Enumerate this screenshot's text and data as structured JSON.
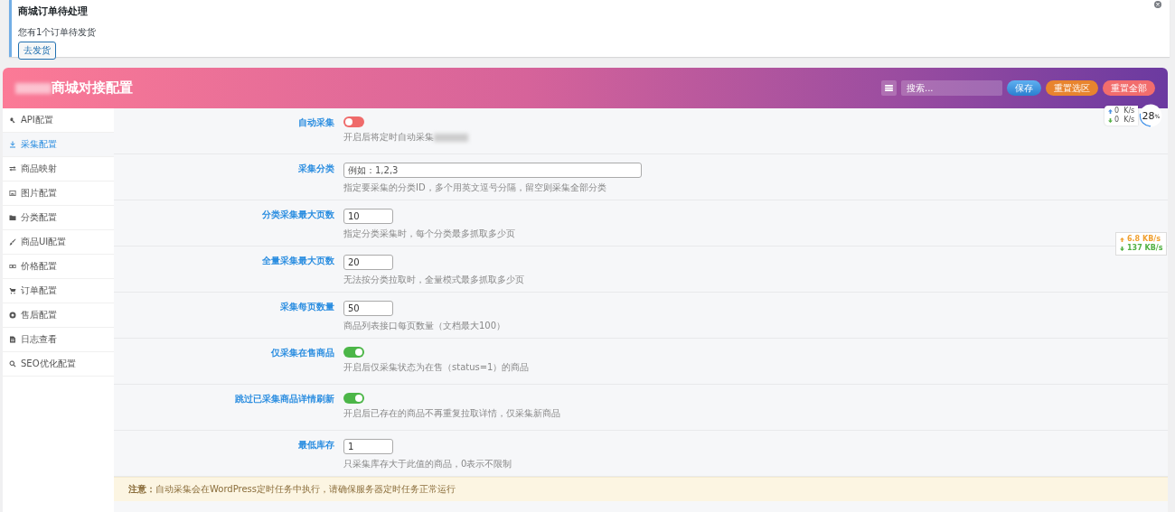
{
  "notice": {
    "title": "商城订单待处理",
    "message": "您有1个订单待发货",
    "button": "去发货"
  },
  "panel": {
    "title": "商城对接配置",
    "search": {
      "placeholder": "搜索..."
    },
    "buttons": [
      {
        "label": "保存",
        "kind": "save"
      },
      {
        "label": "重置选区",
        "kind": "reset"
      },
      {
        "label": "重置全部",
        "kind": "reset_all"
      }
    ]
  },
  "sidebar": {
    "items": [
      {
        "label": "API配置",
        "selected": false
      },
      {
        "label": "采集配置",
        "selected": true
      },
      {
        "label": "商品映射",
        "selected": false
      },
      {
        "label": "图片配置",
        "selected": false
      },
      {
        "label": "分类配置",
        "selected": false
      },
      {
        "label": "商品UI配置",
        "selected": false
      },
      {
        "label": "价格配置",
        "selected": false
      },
      {
        "label": "订单配置",
        "selected": false
      },
      {
        "label": "售后配置",
        "selected": false
      },
      {
        "label": "日志查看",
        "selected": false
      },
      {
        "label": "SEO优化配置",
        "selected": false
      }
    ]
  },
  "fields": [
    {
      "kind": "toggle",
      "label": "自动采集",
      "on": false,
      "hint": "开启后将定时自动采集"
    },
    {
      "kind": "text",
      "label": "采集分类",
      "placeholder": "例如：1,2,3",
      "hint": "指定要采集的分类ID，多个用英文逗号分隔，留空则采集全部分类"
    },
    {
      "kind": "number",
      "label": "分类采集最大页数",
      "value": "10",
      "hint": "指定分类采集时，每个分类最多抓取多少页"
    },
    {
      "kind": "number",
      "label": "全量采集最大页数",
      "value": "20",
      "hint": "无法按分类拉取时，全量模式最多抓取多少页"
    },
    {
      "kind": "number",
      "label": "采集每页数量",
      "value": "50",
      "hint": "商品列表接口每页数量（文档最大100）"
    },
    {
      "kind": "toggle",
      "label": "仅采集在售商品",
      "on": true,
      "hint": "开启后仅采集状态为在售（status=1）的商品"
    },
    {
      "kind": "toggle",
      "label": "跳过已采集商品详情刷新",
      "on": true,
      "hint": "开启后已存在的商品不再重复拉取详情，仅采集新商品"
    },
    {
      "kind": "number",
      "label": "最低库存",
      "value": "1",
      "hint": "只采集库存大于此值的商品，0表示不限制"
    }
  ],
  "note": "**注意：**自动采集会在WordPress定时任务中执行，请确保服务器定时任务正常运行",
  "net_monitor": {
    "upload": "0  K/s",
    "download": "0  K/s",
    "percent": "28",
    "unit": "%"
  },
  "speed_popup": {
    "upload": "6.8 KB/s",
    "download": "137 KB/s"
  }
}
